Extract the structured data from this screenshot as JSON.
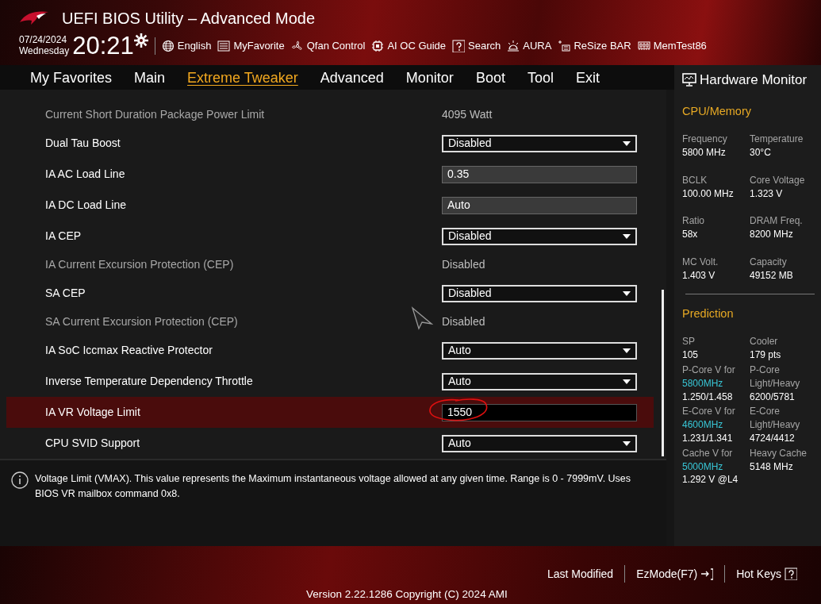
{
  "window": {
    "title": "UEFI BIOS Utility – Advanced Mode"
  },
  "clock": {
    "date": "07/24/2024",
    "weekday": "Wednesday",
    "time": "20:21"
  },
  "toolbar": [
    {
      "label": "English"
    },
    {
      "label": "MyFavorite"
    },
    {
      "label": "Qfan Control"
    },
    {
      "label": "AI OC Guide"
    },
    {
      "label": "Search"
    },
    {
      "label": "AURA"
    },
    {
      "label": "ReSize BAR"
    },
    {
      "label": "MemTest86"
    }
  ],
  "tabs": [
    {
      "label": "My Favorites",
      "selected": false
    },
    {
      "label": "Main",
      "selected": false
    },
    {
      "label": "Extreme Tweaker",
      "selected": true
    },
    {
      "label": "Advanced",
      "selected": false
    },
    {
      "label": "Monitor",
      "selected": false
    },
    {
      "label": "Boot",
      "selected": false
    },
    {
      "label": "Tool",
      "selected": false
    },
    {
      "label": "Exit",
      "selected": false
    }
  ],
  "settings": [
    {
      "kind": "info",
      "label": "Current Short Duration Package Power Limit",
      "value": "4095 Watt",
      "selected": false
    },
    {
      "kind": "select",
      "label": "Dual Tau Boost",
      "value": "Disabled",
      "selected": false
    },
    {
      "kind": "input",
      "label": "IA AC Load Line",
      "value": "0.35",
      "selected": false
    },
    {
      "kind": "input",
      "label": "IA DC Load Line",
      "value": "Auto",
      "selected": false
    },
    {
      "kind": "select",
      "label": "IA CEP",
      "value": "Disabled",
      "selected": false
    },
    {
      "kind": "info",
      "label": "IA Current Excursion Protection (CEP)",
      "value": "Disabled",
      "selected": false
    },
    {
      "kind": "select",
      "label": "SA CEP",
      "value": "Disabled",
      "selected": false
    },
    {
      "kind": "info",
      "label": "SA Current Excursion Protection (CEP)",
      "value": "Disabled",
      "selected": false
    },
    {
      "kind": "select",
      "label": "IA SoC Iccmax Reactive Protector",
      "value": "Auto",
      "selected": false
    },
    {
      "kind": "select",
      "label": "Inverse Temperature Dependency Throttle",
      "value": "Auto",
      "selected": false
    },
    {
      "kind": "input",
      "label": "IA VR Voltage Limit",
      "value": "1550",
      "selected": true
    },
    {
      "kind": "select",
      "label": "CPU SVID Support",
      "value": "Auto",
      "selected": false
    }
  ],
  "help": {
    "text": "Voltage Limit (VMAX). This value represents the Maximum instantaneous voltage allowed at any given time. Range is 0 - 7999mV. Uses BIOS VR mailbox command 0x8."
  },
  "hardware_monitor": {
    "title": "Hardware Monitor",
    "sections": [
      {
        "title": "CPU/Memory",
        "items": [
          {
            "label": "Frequency",
            "value": "5800 MHz"
          },
          {
            "label": "Temperature",
            "value": "30°C"
          },
          {
            "label": "BCLK",
            "value": "100.00 MHz"
          },
          {
            "label": "Core Voltage",
            "value": "1.323 V"
          },
          {
            "label": "Ratio",
            "value": "58x"
          },
          {
            "label": "DRAM Freq.",
            "value": "8200 MHz"
          },
          {
            "label": "MC Volt.",
            "value": "1.403 V"
          },
          {
            "label": "Capacity",
            "value": "49152 MB"
          }
        ]
      },
      {
        "title": "Prediction",
        "items": [
          {
            "label": "SP",
            "value": "105"
          },
          {
            "label": "Cooler",
            "value": "179 pts"
          },
          {
            "label": "P-Core V for",
            "freq": "5800MHz",
            "value": "1.250/1.458"
          },
          {
            "label": "P-Core Light/Heavy",
            "value": "6200/5781"
          },
          {
            "label": "E-Core V for",
            "freq": "4600MHz",
            "value": "1.231/1.341"
          },
          {
            "label": "E-Core Light/Heavy",
            "value": "4724/4412"
          },
          {
            "label": "Cache V for",
            "freq": "5000MHz",
            "value": "1.292 V @L4"
          },
          {
            "label": "Heavy Cache",
            "value": "5148 MHz"
          }
        ]
      }
    ]
  },
  "footer": {
    "actions": [
      {
        "label": "Last Modified"
      },
      {
        "label": "EzMode(F7)"
      },
      {
        "label": "Hot Keys"
      }
    ],
    "version": "Version 2.22.1286 Copyright (C) 2024 AMI"
  }
}
